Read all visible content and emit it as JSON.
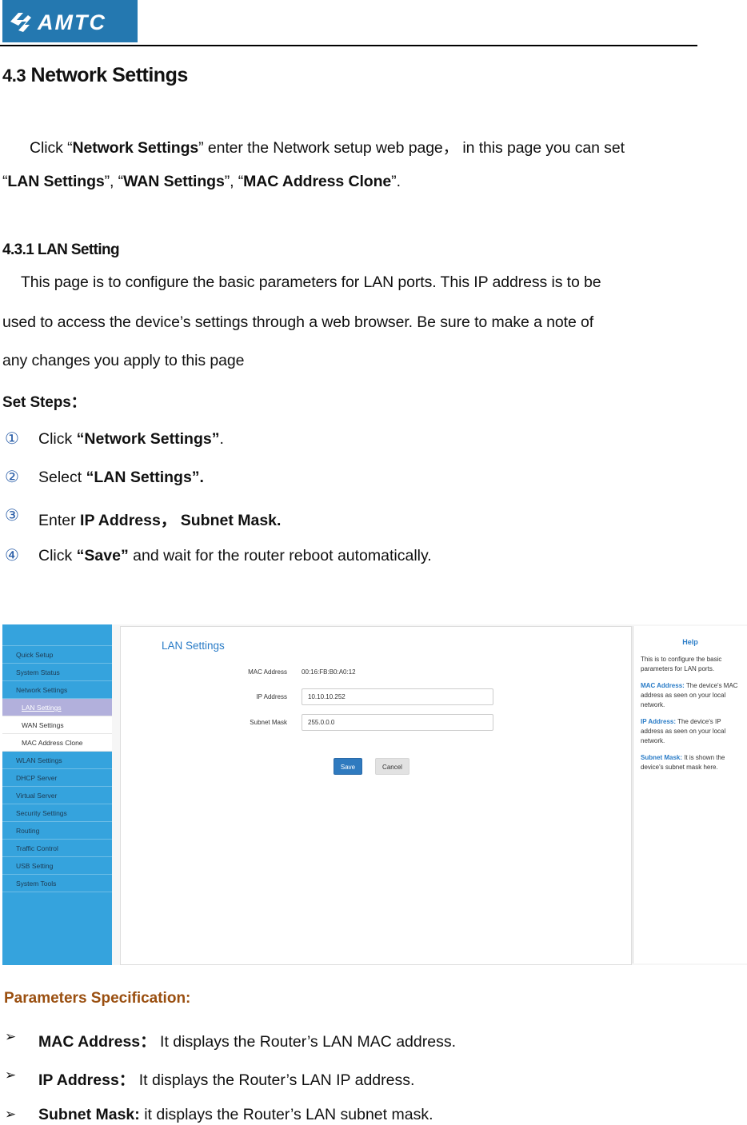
{
  "header": {
    "logo_text": "AMTC",
    "brand_color": "#2478b0"
  },
  "section": {
    "number": "4.3",
    "title": "Network Settings",
    "intro_line1_pre": "Click “",
    "intro_line1_bold": "Network Settings",
    "intro_line1_post": "” enter the Network setup web page， in this page you can set",
    "intro_line2": [
      {
        "text": "“",
        "bold": false
      },
      {
        "text": "LAN Settings",
        "bold": true
      },
      {
        "text": "”, “",
        "bold": false
      },
      {
        "text": "WAN Settings",
        "bold": true
      },
      {
        "text": "”, “",
        "bold": false
      },
      {
        "text": "MAC Address Clone",
        "bold": true
      },
      {
        "text": "”.",
        "bold": false
      }
    ]
  },
  "subsection": {
    "title": "4.3.1 LAN Setting",
    "paragraph_lines": [
      "This page is to configure the basic parameters for LAN ports. This IP address is to be",
      "used to access the device’s settings through a web browser. Be sure to make a note of",
      "any changes you apply to this page"
    ],
    "steps_title": "Set Steps：",
    "steps": [
      {
        "num": "①",
        "pre": "Click ",
        "bold": "“Network Settings”",
        "post": "."
      },
      {
        "num": "②",
        "pre": "Select ",
        "bold": "“LAN Settings”.",
        "post": ""
      },
      {
        "num": "③",
        "pre": "Enter ",
        "bold": "IP Address， Subnet Mask.",
        "post": ""
      },
      {
        "num": "④",
        "pre": "Click ",
        "bold": "“Save”",
        "post": " and wait for the router reboot automatically."
      }
    ]
  },
  "router_ui": {
    "sidebar": [
      {
        "label": "Quick Setup",
        "type": "main"
      },
      {
        "label": "System Status",
        "type": "main"
      },
      {
        "label": "Network Settings",
        "type": "main"
      },
      {
        "label": "LAN Settings",
        "type": "sub",
        "active": true
      },
      {
        "label": "WAN Settings",
        "type": "sub"
      },
      {
        "label": "MAC Address Clone",
        "type": "sub"
      },
      {
        "label": "WLAN Settings",
        "type": "main"
      },
      {
        "label": "DHCP Server",
        "type": "main"
      },
      {
        "label": "Virtual Server",
        "type": "main"
      },
      {
        "label": "Security Settings",
        "type": "main"
      },
      {
        "label": "Routing",
        "type": "main"
      },
      {
        "label": "Traffic Control",
        "type": "main"
      },
      {
        "label": "USB Setting",
        "type": "main"
      },
      {
        "label": "System Tools",
        "type": "main"
      }
    ],
    "page_title": "LAN Settings",
    "form": {
      "mac_label": "MAC Address",
      "mac_value": "00:16:FB:B0:A0:12",
      "ip_label": "IP Address",
      "ip_value": "10.10.10.252",
      "mask_label": "Subnet Mask",
      "mask_value": "255.0.0.0"
    },
    "buttons": {
      "save": "Save",
      "cancel": "Cancel"
    },
    "help": {
      "title": "Help",
      "intro": [
        "This is to configure the basic",
        "parameters for LAN ports."
      ],
      "items": [
        {
          "key": "MAC Address:",
          "lines": [
            " The device's MAC",
            "address as seen on your local",
            "network."
          ]
        },
        {
          "key": "IP Address:",
          "lines": [
            " The device's IP",
            "address as seen on your local",
            "network."
          ]
        },
        {
          "key": "Subnet Mask:",
          "lines": [
            " It is shown the",
            "device's subnet mask here."
          ]
        }
      ]
    }
  },
  "parameters": {
    "title": "Parameters Specification:",
    "title_color": "#9a4f10",
    "bullet_glyph": "➢",
    "items": [
      {
        "term": "MAC Address：",
        "desc": " It displays the Router’s LAN MAC address."
      },
      {
        "term": "IP Address：",
        "desc": " It displays the Router’s LAN IP address."
      },
      {
        "term": "Subnet Mask:",
        "desc": " it displays the Router’s LAN subnet mask."
      }
    ]
  }
}
